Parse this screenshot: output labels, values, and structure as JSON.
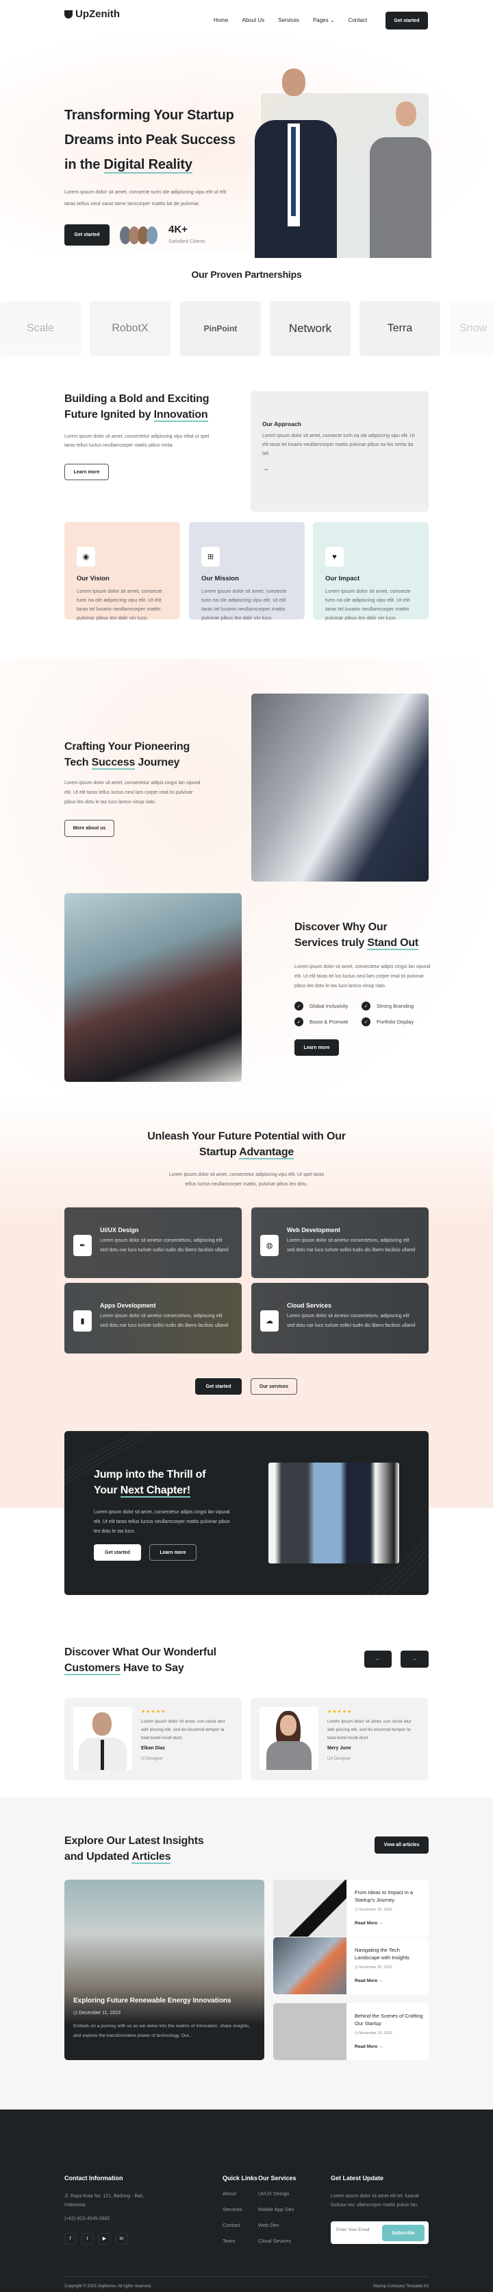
{
  "brand": {
    "name": "UpZenith",
    "accent": "#7cc8c4",
    "dark": "#1f2224"
  },
  "nav": {
    "items": [
      "Home",
      "About Us",
      "Services",
      "Pages",
      "Contact"
    ],
    "cta": "Get started"
  },
  "hero": {
    "title_pre": "Transforming Your Startup Dreams into Peak Success in the ",
    "title_hl": "Digital Reality",
    "desc": "Lorem ipsum dolor sit amet, consecte turin ole adipiscing vipu elit ut elit taras tellus neul sarat tame lamcorper mattis lat de pulvinar.",
    "cta": "Get started",
    "stat": "4K+",
    "stat_label": "Satisfied Clients"
  },
  "partners": {
    "title": "Our Proven Partnerships",
    "logos": [
      "Scale",
      "RobotX",
      "PinPoint",
      "Network",
      "Terra",
      "Snow"
    ]
  },
  "building": {
    "title_pre": "Building a Bold and Exciting Future Ignited by ",
    "title_hl": "Innovation",
    "desc": "Lorem ipsum dolor sit amet, consectetur adipiscing vipu elital ut spel taras tellus luctus neullamcorper mattis pibus ronta.",
    "button": "Learn more",
    "approach": {
      "title": "Our Approach",
      "desc": "Lorem ipsum dolor sit amet, consecte turin na ole adipiscing vipu elit. Ut elit taras tel lusario neullamcorper mattis pulvinar pibus na leo senta da lait."
    },
    "cards": [
      {
        "title": "Our Vision",
        "icon": "compass-icon",
        "desc": "Lorem ipsum dolor sit amet, consecte turin na ole adipiscing vipu elit. Ut elit taras tel lusario neullamcorper mattis pulvinar pibus leo dalir vin luco."
      },
      {
        "title": "Our Mission",
        "icon": "network-icon",
        "desc": "Lorem ipsum dolor sit amet, consecte turin na ole adipiscing vipu elit. Ut elit taras tel lusario neullamcorper mattis pulvinar pibus leo dalir vin luco."
      },
      {
        "title": "Our Impact",
        "icon": "hand-heart-icon",
        "desc": "Lorem ipsum dolor sit amet, consecte turin na ole adipiscing vipu elit. Ut elit taras tel lusario neullamcorper mattis pulvinar pibus leo dalir vin luco."
      }
    ]
  },
  "crafting": {
    "title_pre": "Crafting Your Pioneering Tech ",
    "title_hl": "Success",
    "title_post": " Journey",
    "desc": "Lorem ipsum dolor sit amet, consectetur adipis cingsi lan vipural elit. Ut elit taras tellus luctus neul lam corper imat tis pulvinar pibus leo dotu le tas luco lamco vinup riato.",
    "button": "More about us"
  },
  "discover": {
    "title_pre": "Discover Why Our Services truly ",
    "title_hl": "Stand Out",
    "desc": "Lorem ipsum dolor sit amet, consectetur adipis cingsi lan vipural elit. Ut elit taras tel lus luctus neul lam corper imal tis pulvinar pibus leo dotu le tas luco lamco vinup riato.",
    "features": [
      "Global Inclusivity",
      "Strong Branding",
      "Boost & Promote",
      "Portfolio Display"
    ],
    "button": "Learn more"
  },
  "services": {
    "title_pre": "Unleash Your Future Potential with Our Startup ",
    "title_hl": "Advantage",
    "desc": "Lorem ipsum dolor sit amet, consectetur adipiscing vipu elit. Ut spel taras tellus luctus neullamcorper mattis, pulvinar pibus leo dotu.",
    "items": [
      {
        "title": "UI/UX Design",
        "icon": "pen-tool-icon",
        "desc": "Lorem ipsum dolor sit ametur consecteturu, adipiscing elit sed dotu nar luco turlute sollici tudin dis libero facilisis ullamil"
      },
      {
        "title": "Web Development",
        "icon": "globe-icon",
        "desc": "Lorem ipsum dolor sit ametur consecteturu, adipiscing elit sed dotu nar luco turlute sollici tudin dis libero facilisis ullamil"
      },
      {
        "title": "Apps Development",
        "icon": "mobile-icon",
        "desc": "Lorem ipsum dolor sit ametur consecteturu, adipiscing elit sed dotu nar luco turlute sollici tudin dis libero facilisis ullamil"
      },
      {
        "title": "Cloud Services",
        "icon": "cloud-upload-icon",
        "desc": "Lorem ipsum dolor sit ametur consecteturu, adipiscing elit sed dotu nar luco turlute sollici tudin dis libero facilisis ullamil"
      }
    ],
    "primary": "Get started",
    "secondary": "Our services"
  },
  "cta": {
    "title_pre": "Jump into the Thrill of Your ",
    "title_hl": "Next Chapter!",
    "desc": "Lorem ipsum dolor sit amet, consectetur adipis cingsi lan vipural elit. Ut elit taras tellus luctus neullamcorper mattis pulvinar pibus leo dotu le tas luco.",
    "primary": "Get started",
    "secondary": "Learn more"
  },
  "testimonials": {
    "title_hl": "Customers",
    "title_pre": "Discover What Our Wonderful ",
    "title_post": " Have to Say",
    "rating": 5,
    "stars": "★★★★★",
    "items": [
      {
        "text": "Lorem ipsum dolor sit amet, con secte atur adir piscing elit, sed do eiusmod tempor la tulat korel incidi dunt.",
        "name": "Elkan Diaz",
        "role": "UI Designer"
      },
      {
        "text": "Lorem ipsum dolor sit amet, con secte atur adir piscing elit, sed do eiusmod tempor la tulat korel incidi dunt.",
        "name": "Mery June",
        "role": "UX Designer"
      }
    ]
  },
  "insights": {
    "title_pre": "Explore Our Latest Insights and Updated ",
    "title_hl": "Articles",
    "button": "View all articles",
    "featured": {
      "title": "Exploring Future Renewable Energy Innovations",
      "date": "December 11, 2023",
      "excerpt": "Embark on a journey with us as we delve into the realms of innovation, share insights, and explore the transformative power of technology. Our..."
    },
    "articles": [
      {
        "title": "From Ideas to Impact in a Startup's Journey",
        "date": "November 20, 2023",
        "link": "Read More"
      },
      {
        "title": "Navigating the Tech Landscape with Insights",
        "date": "November 20, 2023",
        "link": "Read More"
      },
      {
        "title": "Behind the Scenes of Crafting Our Startup",
        "date": "November 20, 2023",
        "link": "Read More"
      }
    ]
  },
  "footer": {
    "contact": {
      "title": "Contact Information",
      "address": "Jl. Raya Kuta No. 121, Badung - Bali, Indonesia.",
      "phone": "(+62)-822-4545-2882"
    },
    "quick": {
      "title": "Quick Links",
      "items": [
        "About",
        "Services",
        "Contact",
        "Team"
      ]
    },
    "services": {
      "title": "Our Services",
      "items": [
        "UI/UX Design",
        "Mobile App Dev",
        "Web Dev",
        "Cloud Sevices"
      ]
    },
    "update": {
      "title": "Get Latest Update",
      "desc": "Lorem ipsum dolor sit amet elit tel, lusinal luctusa nec ullamcorper mattis pulvin lan.",
      "placeholder": "Enter Your Email",
      "button": "Subscribe"
    },
    "copyright": "Copyright © 2023 Jegtheme. All rights reserved.",
    "kit": "Startup Company Template Kit"
  }
}
